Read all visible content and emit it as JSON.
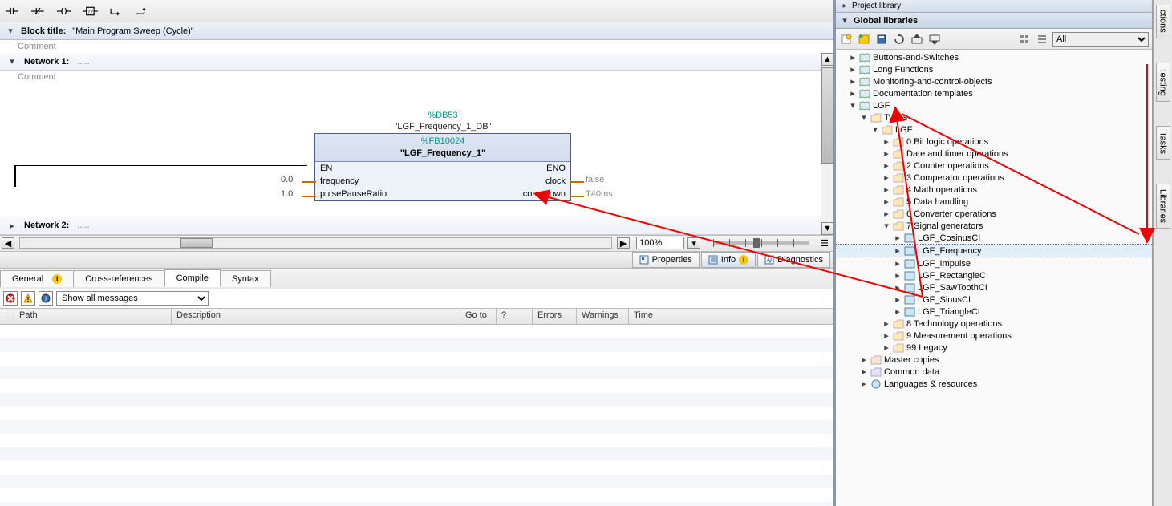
{
  "toolbar": {
    "btn1": "contact-open",
    "btn2": "contact-closed",
    "btn3": "coil",
    "btn4": "empty-box",
    "btn5": "branch-open",
    "btn6": "branch-close"
  },
  "block": {
    "label": "Block title:",
    "title": "\"Main Program Sweep (Cycle)\"",
    "comment": "Comment"
  },
  "network1": {
    "label": "Network 1:",
    "extra": ".....",
    "comment": "Comment"
  },
  "network2": {
    "label": "Network 2:",
    "extra": "....."
  },
  "fb": {
    "db_id": "%DB53",
    "db_name": "\"LGF_Frequency_1_DB\"",
    "fb_id": "%FB10024",
    "fb_name": "\"LGF_Frequency_1\"",
    "en": "EN",
    "eno": "ENO",
    "in1": "frequency",
    "in1_val": "0.0",
    "in2": "pulsePauseRatio",
    "in2_val": "1.0",
    "out1": "clock",
    "out1_val": "false",
    "out2": "countdown",
    "out2_val": "T#0ms"
  },
  "zoom": {
    "value": "100%"
  },
  "proptabs": {
    "properties": "Properties",
    "info": "Info",
    "diagnostics": "Diagnostics"
  },
  "ctabs": {
    "general": "General",
    "cross": "Cross-references",
    "compile": "Compile",
    "syntax": "Syntax"
  },
  "msgfilter": {
    "selected": "Show all messages"
  },
  "msgcols": {
    "c0": "!",
    "c1": "Path",
    "c2": "Description",
    "c3": "Go to",
    "c4": "?",
    "c5": "Errors",
    "c6": "Warnings",
    "c7": "Time"
  },
  "gl": {
    "header0": "Project library",
    "header": "Global libraries",
    "filter": "All",
    "items": [
      "Buttons-and-Switches",
      "Long Functions",
      "Monitoring-and-control-objects",
      "Documentation templates",
      "LGF"
    ],
    "types": "Types",
    "lgf": "LGF",
    "folders": [
      "0 Bit logic operations",
      "Date and timer operations",
      "2 Counter operations",
      "3 Comperator operations",
      "4 Math operations",
      "5 Data handling",
      "6 Converter operations",
      "7 Signal generators",
      "8 Technology operations",
      "9 Measurement operations",
      "99 Legacy"
    ],
    "sig": [
      "LGF_CosinusCI",
      "LGF_Frequency",
      "LGF_Impulse",
      "LGF_RectangleCI",
      "LGF_SawToothCI",
      "LGF_SinusCI",
      "LGF_TriangleCI"
    ],
    "bottom": [
      "Master copies",
      "Common data",
      "Languages & resources"
    ]
  },
  "vtabs": {
    "t0": "ctions",
    "t1": "Testing",
    "t2": "Tasks",
    "t3": "Libraries"
  }
}
